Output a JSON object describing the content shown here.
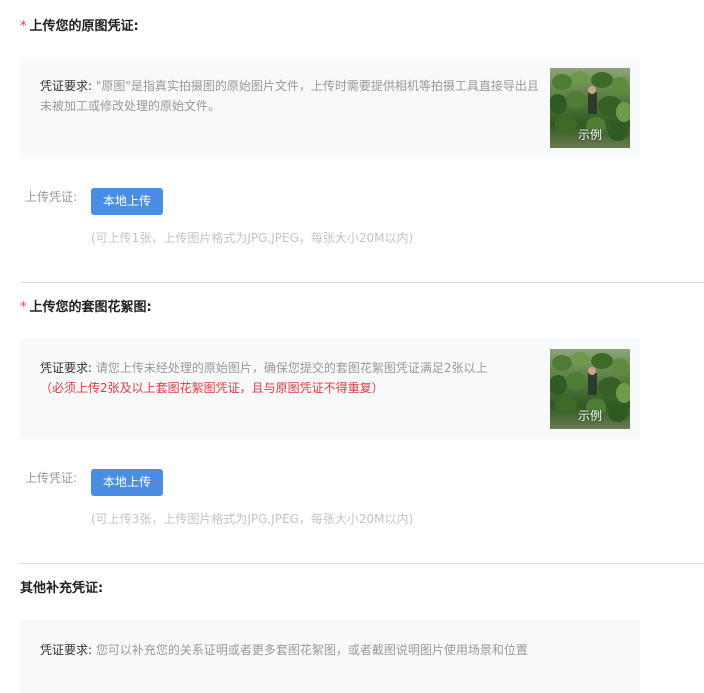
{
  "sections": [
    {
      "required_mark": "*",
      "title": "上传您的原图凭证:",
      "requirement_label": "凭证要求:",
      "requirement_text": " \"原图\"是指真实拍摄图的原始图片文件，上传时需要提供相机等拍摄工具直接导出且未被加工或修改处理的原始文件。",
      "example_label": "示例",
      "upload_label": "上传凭证:",
      "upload_button": "本地上传",
      "upload_hint": "(可上传1张，上传图片格式为JPG,JPEG，每张大小20M以内)"
    },
    {
      "required_mark": "*",
      "title": "上传您的套图花絮图:",
      "requirement_label": "凭证要求:",
      "requirement_text": " 请您上传未经处理的原始图片，确保您提交的套图花絮图凭证满足2张以上",
      "requirement_red": "（必须上传2张及以上套图花絮图凭证，且与原图凭证不得重复）",
      "example_label": "示例",
      "upload_label": "上传凭证:",
      "upload_button": "本地上传",
      "upload_hint": "(可上传3张，上传图片格式为JPG,JPEG，每张大小20M以内)"
    },
    {
      "title": "其他补充凭证:",
      "requirement_label": "凭证要求:",
      "requirement_text": " 您可以补充您的关系证明或者更多套图花絮图，或者截图说明图片使用场景和位置"
    }
  ],
  "colors": {
    "required": "#e4393c",
    "button": "#4a8ee4",
    "box_bg": "#f8f9fb",
    "divider": "#dcdcdc",
    "hint": "#c4c4c4"
  },
  "icons": {
    "example_image": "plant-photo-thumbnail"
  }
}
